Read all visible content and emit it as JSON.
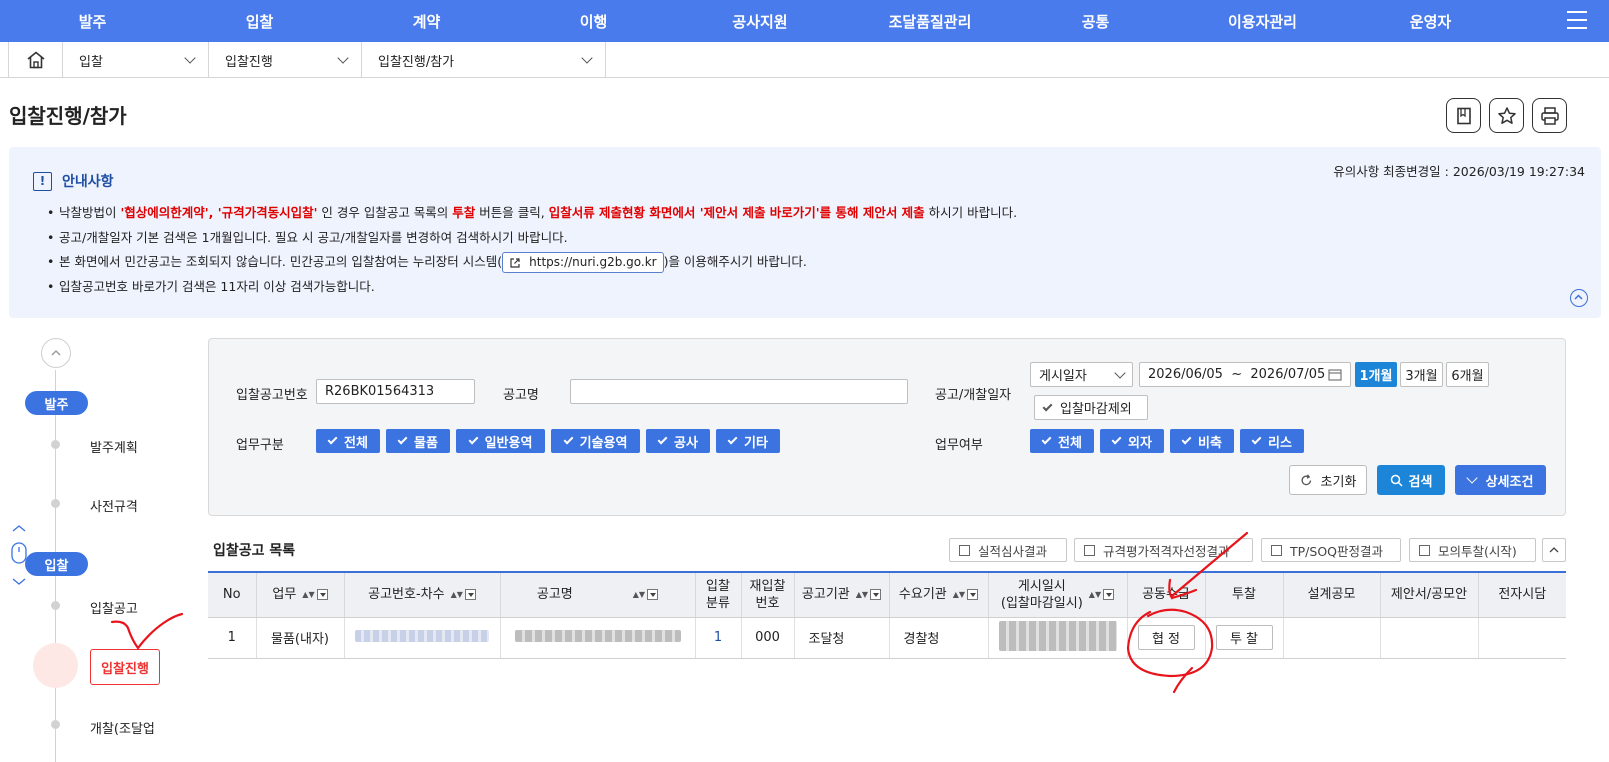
{
  "nav": {
    "items": [
      "발주",
      "입찰",
      "계약",
      "이행",
      "공사지원",
      "조달품질관리",
      "공통",
      "이용자관리",
      "운영자"
    ]
  },
  "breadcrumb": {
    "level1": "입찰",
    "level2": "입찰진행",
    "level3": "입찰진행/참가"
  },
  "page": {
    "title": "입찰진행/참가"
  },
  "notice": {
    "title": "안내사항",
    "updated": "유의사항 최종변경일 : 2026/03/19 19:27:34",
    "l1_a": "낙찰방법이 ",
    "l1_b": "'협상에의한계약', '규격가격동시입찰'",
    "l1_c": " 인 경우 입찰공고 목록의 ",
    "l1_d": "투찰",
    "l1_e": " 버튼을 클릭, ",
    "l1_f": "입찰서류 제출현황 화면에서 '제안서 제출 바로가기'를 통해 제안서 제출",
    "l1_g": " 하시기 바랍니다.",
    "l2": "공고/개찰일자 기본 검색은 1개월입니다. 필요 시 공고/개찰일자를 변경하여 검색하시기 바랍니다.",
    "l3_a": "본 화면에서 민간공고는 조회되지 않습니다. 민간공고의 입찰참여는 누리장터 시스템(",
    "l3_link": "https://nuri.g2b.go.kr",
    "l3_b": ")을 이용해주시기 바랍니다.",
    "l4": "입찰공고번호 바로가기 검색은 11자리 이상 검색가능합니다."
  },
  "sidebar": {
    "pill1": "발주",
    "item1": "발주계획",
    "item2": "사전규격",
    "pill2": "입찰",
    "item3": "입찰공고",
    "active": "입찰진행",
    "item4": "개찰(조달업"
  },
  "search": {
    "bid_no_label": "입찰공고번호",
    "bid_no_value": "R26BK01564313",
    "name_label": "공고명",
    "name_value": "",
    "date_label": "공고/개찰일자",
    "date_type": "게시일자",
    "date_from": "2026/06/05",
    "date_tilde": "~",
    "date_to": "2026/07/05",
    "periods": [
      "1개월",
      "3개월",
      "6개월"
    ],
    "exclude_closed": "입찰마감제외",
    "biz_label": "업무구분",
    "biz_options": [
      "전체",
      "물품",
      "일반용역",
      "기술용역",
      "공사",
      "기타"
    ],
    "biz2_label": "업무여부",
    "biz2_options": [
      "전체",
      "외자",
      "비축",
      "리스"
    ],
    "reset": "초기화",
    "search": "검색",
    "detail": "상세조건"
  },
  "list": {
    "title": "입찰공고 목록",
    "ext_buttons": [
      "실적심사결과",
      "규격평가적격자선정결과",
      "TP/SOQ판정결과",
      "모의투찰(시작)"
    ],
    "headers": [
      "No",
      "업무",
      "공고번호-차수",
      "공고명",
      "입찰\n분류",
      "재입찰\n번호",
      "공고기관",
      "수요기관",
      "게시일시\n(입찰마감일시)",
      "공동수급",
      "투찰",
      "설계공모",
      "제안서/공모안",
      "전자시담"
    ],
    "row": {
      "no": "1",
      "biz": "물품(내자)",
      "bid_class": "1",
      "rebid": "000",
      "org": "조달청",
      "demand": "경찰청",
      "joint_btn": "협 정",
      "bid_btn": "투 찰"
    }
  },
  "colors": {
    "nav": "#4a7bec",
    "accent": "#3b73e0",
    "alert": "#e00000"
  }
}
